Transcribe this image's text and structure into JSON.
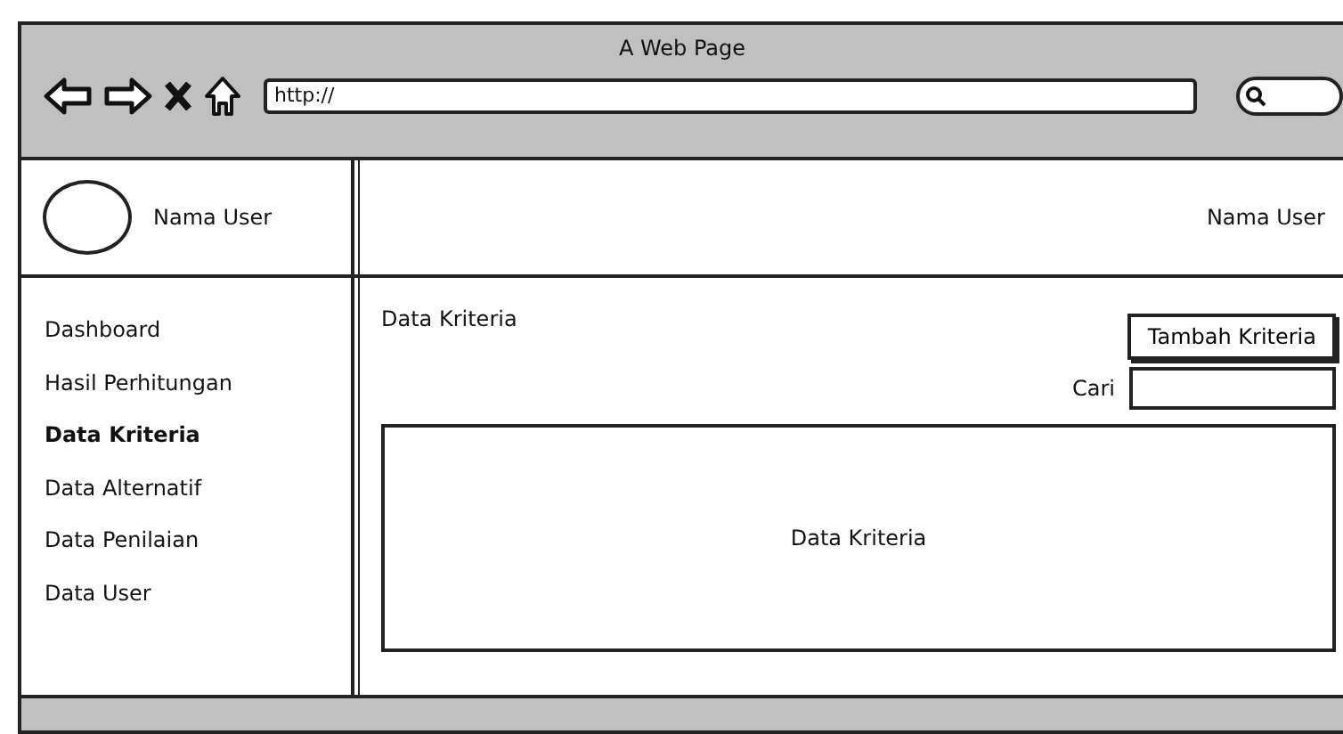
{
  "window": {
    "title": "A Web Page"
  },
  "address_bar": {
    "value": "http://"
  },
  "header": {
    "user_name": "Nama User",
    "top_bar_user": "Nama User"
  },
  "sidebar": {
    "items": [
      {
        "label": "Dashboard",
        "selected": false
      },
      {
        "label": "Hasil Perhitungan",
        "selected": false
      },
      {
        "label": "Data Kriteria",
        "selected": true
      },
      {
        "label": "Data Alternatif",
        "selected": false
      },
      {
        "label": "Data Penilaian",
        "selected": false
      },
      {
        "label": "Data User",
        "selected": false
      }
    ]
  },
  "content": {
    "title": "Data Kriteria",
    "add_button": "Tambah Kriteria",
    "search_label": "Cari",
    "panel_text": "Data Kriteria"
  }
}
